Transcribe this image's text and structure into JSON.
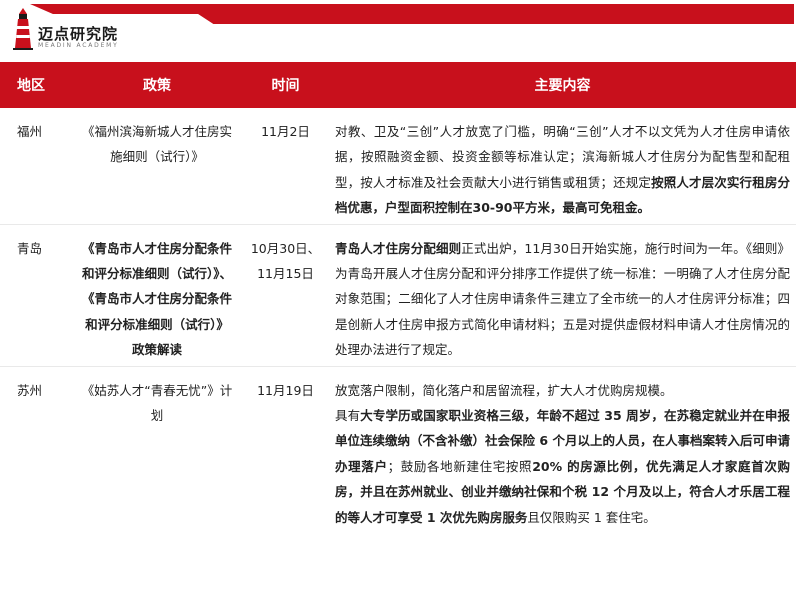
{
  "brand": {
    "name": "迈点研究院",
    "subtitle": "MEADIN ACADEMY",
    "accent_color": "#c8101c"
  },
  "table": {
    "headers": {
      "region": "地区",
      "policy": "政策",
      "time": "时间",
      "content": "主要内容"
    },
    "rows": [
      {
        "region": "福州",
        "policy": "《福州滨海新城人才住房实施细则（试行）》",
        "time": [
          "11月2日"
        ],
        "content": {
          "p1": "对教、卫及“三创”人才放宽了门槛，明确“三创”人才不以文凭为人才住房申请依据，按照融资金额、投资金额等标准认定；滨海新城人才住房分为配售型和配租型，按人才标准及社会贡献大小进行销售或租赁；还规定",
          "b1": "按照人才层次实行租房分档优惠，户型面积控制在30-90平方米，最高可免租金。"
        }
      },
      {
        "region": "青岛",
        "policy": "《青岛市人才住房分配条件和评分标准细则（试行）》、《青岛市人才住房分配条件和评分标准细则（试行）》政策解读",
        "time": [
          "10月30日、",
          "11月15日"
        ],
        "content": {
          "b1": "青岛人才住房分配细则",
          "p1": "正式出炉，11月30日开始实施，施行时间为一年。《细则》为青岛开展人才住房分配和评分排序工作提供了统一标准：一明确了人才住房分配对象范围；二细化了人才住房申请条件三建立了全市统一的人才住房评分标准；四是创新人才住房申报方式简化申请材料；五是对提供虚假材料申请人才住房情况的处理办法进行了规定。"
        }
      },
      {
        "region": "苏州",
        "policy": "《姑苏人才“青春无忧”》计划",
        "time": [
          "11月19日"
        ],
        "content": {
          "line1": "放宽落户限制，简化落户和居留流程，扩大人才优购房规模。",
          "p1": "具有",
          "b1": "大专学历或国家职业资格三级，年龄不超过 35 周岁，在苏稳定就业并在申报单位连续缴纳（不含补缴）社会保险 6 个月以上的人员，在人事档案转入后可申请办理落户",
          "p2": "；鼓励各地新建住宅按照",
          "b2": "20% 的房源比例，优先满足人才家庭首次购房，并且在苏州就业、创业并缴纳社保和个税 12 个月及以上，符合人才乐居工程的等人才可享受 1 次优先购房服务",
          "p3": "且仅限购买 1 套住宅。"
        }
      }
    ]
  }
}
